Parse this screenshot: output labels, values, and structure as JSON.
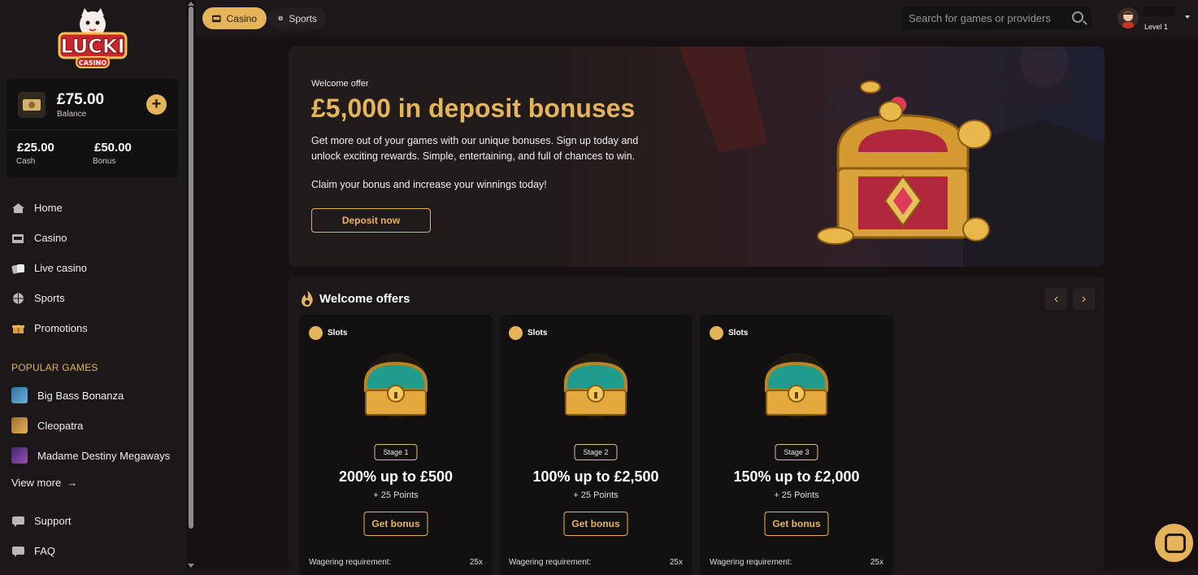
{
  "brand": {
    "logo_text": "LUCKI",
    "logo_sub": "CASINO"
  },
  "wallet": {
    "balance": "£75.00",
    "balance_label": "Balance",
    "add": "+",
    "cash": "£25.00",
    "cash_label": "Cash",
    "bonus": "£50.00",
    "bonus_label": "Bonus"
  },
  "nav": [
    {
      "label": "Home",
      "icon": "home-icon"
    },
    {
      "label": "Casino",
      "icon": "slot-machine-icon"
    },
    {
      "label": "Live casino",
      "icon": "live-casino-icon"
    },
    {
      "label": "Sports",
      "icon": "ball-icon"
    },
    {
      "label": "Promotions",
      "icon": "gift-icon"
    }
  ],
  "popular": {
    "heading": "POPULAR GAMES",
    "games": [
      "Big Bass Bonanza",
      "Cleopatra",
      "Madame Destiny Megaways"
    ],
    "view_more": "View more"
  },
  "footer_nav": [
    {
      "label": "Support",
      "icon": "chat-icon"
    },
    {
      "label": "FAQ",
      "icon": "faq-icon"
    }
  ],
  "top": {
    "tab_casino": "Casino",
    "tab_sports": "Sports",
    "search_placeholder": "Search for games or providers",
    "level": "Level 1"
  },
  "hero": {
    "small": "Welcome offer",
    "title": "£5,000 in deposit bonuses",
    "desc": "Get more out of your games with our unique bonuses. Sign up today and unlock exciting rewards. Simple, entertaining, and full of chances to win.",
    "claim": "Claim your bonus and increase your winnings today!",
    "button": "Deposit now"
  },
  "offers": {
    "title": "Welcome offers",
    "cards": [
      {
        "category": "Slots",
        "stage": "Stage 1",
        "amount": "200% up to £500",
        "points": "+ 25 Points",
        "button": "Get bonus",
        "wager_label": "Wagering requirement:",
        "wager_value": "25x"
      },
      {
        "category": "Slots",
        "stage": "Stage 2",
        "amount": "100% up to £2,500",
        "points": "+ 25 Points",
        "button": "Get bonus",
        "wager_label": "Wagering requirement:",
        "wager_value": "25x"
      },
      {
        "category": "Slots",
        "stage": "Stage 3",
        "amount": "150% up to £2,000",
        "points": "+ 25 Points",
        "button": "Get bonus",
        "wager_label": "Wagering requirement:",
        "wager_value": "25x"
      }
    ]
  },
  "colors": {
    "accent": "#e4b35a",
    "bg": "#161213",
    "panel": "#1c1719"
  }
}
